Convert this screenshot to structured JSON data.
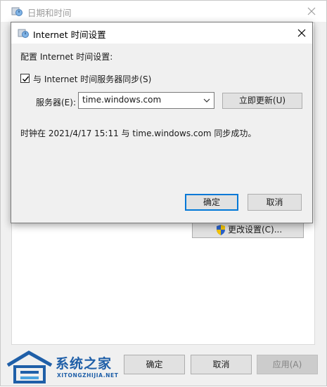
{
  "outer_window": {
    "title": "日期和时间",
    "change_settings_label": "更改设置(C)...",
    "ok_label": "确定",
    "cancel_label": "取消",
    "apply_label": "应用(A)"
  },
  "dialog": {
    "title": "Internet 时间设置",
    "config_label": "配置 Internet 时间设置:",
    "sync_checkbox": {
      "label": "与 Internet 时间服务器同步(S)",
      "checked": true
    },
    "server_label": "服务器(E):",
    "server_value": "time.windows.com",
    "update_now_label": "立即更新(U)",
    "status_text": "时钟在 2021/4/17 15:11 与 time.windows.com 同步成功。",
    "ok_label": "确定",
    "cancel_label": "取消"
  },
  "watermark": {
    "brand": "系统之家",
    "url": "XITONGZHIJIA.NET"
  },
  "colors": {
    "accent": "#0078d7",
    "window_bg": "#f0f0f0",
    "watermark": "#1f5fa8"
  },
  "icons": [
    "clock-globe-icon",
    "close-icon",
    "checkmark-icon",
    "chevron-down-icon",
    "uac-shield-icon"
  ]
}
